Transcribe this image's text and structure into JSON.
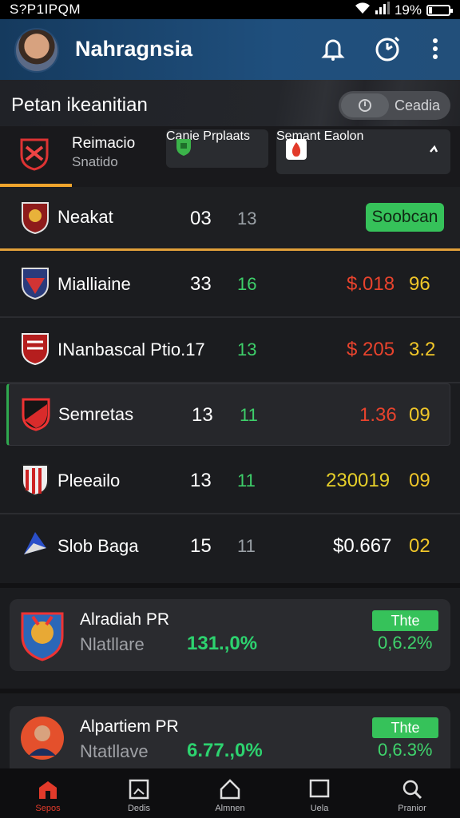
{
  "status_bar": {
    "time": "S?P1IPQM",
    "battery": "19%"
  },
  "app_bar": {
    "title": "Nahragnsia",
    "icons": [
      "avatar",
      "bell-icon",
      "clock-icon",
      "more-vert-icon"
    ]
  },
  "section": {
    "title": "Petan ikeanitian",
    "toggle_label": "Ceadia"
  },
  "tabs": [
    {
      "title": "Reimacio",
      "sub": "Snatido"
    },
    {
      "title": "Canie",
      "sub": "Prplaats"
    },
    {
      "title": "Semant",
      "sub": "Eaolon"
    }
  ],
  "header_row": {
    "name": "Neakat",
    "n1": "03",
    "n2": "13",
    "action": "Soobcan"
  },
  "rows": [
    {
      "name": "Mialliaine",
      "n1": "33",
      "n2": "16",
      "value": "$.018",
      "value_color": "#e8432d",
      "points": "96"
    },
    {
      "name": "INanbascal Ptio.17",
      "n1": "",
      "n2": "13",
      "value": "$ 205",
      "value_color": "#e8432d",
      "points": "3.2"
    },
    {
      "name": "Semretas",
      "n1": "13",
      "n2": "11",
      "value": "1.36",
      "value_color": "#e8432d",
      "points": "09"
    },
    {
      "name": "Pleeailo",
      "n1": "13",
      "n2": "11",
      "value": "230019",
      "value_color": "#e6cf2a",
      "points": "09"
    },
    {
      "name": "Slob Baga",
      "n1": "15",
      "n2": "11",
      "value": "$0.667",
      "value_color": "#ffffff",
      "points": "02"
    }
  ],
  "cards": [
    {
      "name": "Alradiah PR",
      "sub": "Nlatllare",
      "value": "131.,0%",
      "badge": "Thte",
      "pct": "0,6.2%"
    },
    {
      "name": "Alpartiem PR",
      "sub": "Ntatllave",
      "value": "6.77.,0%",
      "badge": "Thte",
      "pct": "0,6.3%"
    }
  ],
  "bottom_nav": [
    {
      "label": "Sepos",
      "icon": "home-icon",
      "active": true
    },
    {
      "label": "Dedis",
      "icon": "picture-icon",
      "active": false
    },
    {
      "label": "Almnen",
      "icon": "house-outline-icon",
      "active": false
    },
    {
      "label": "Uela",
      "icon": "square-icon",
      "active": false
    },
    {
      "label": "Pranior",
      "icon": "search-icon",
      "active": false
    }
  ],
  "colors": {
    "accent": "#f0a52d",
    "green": "#36c25a",
    "appbar": "#1f4f7d",
    "red": "#e8432d",
    "yellow": "#f0c629"
  }
}
